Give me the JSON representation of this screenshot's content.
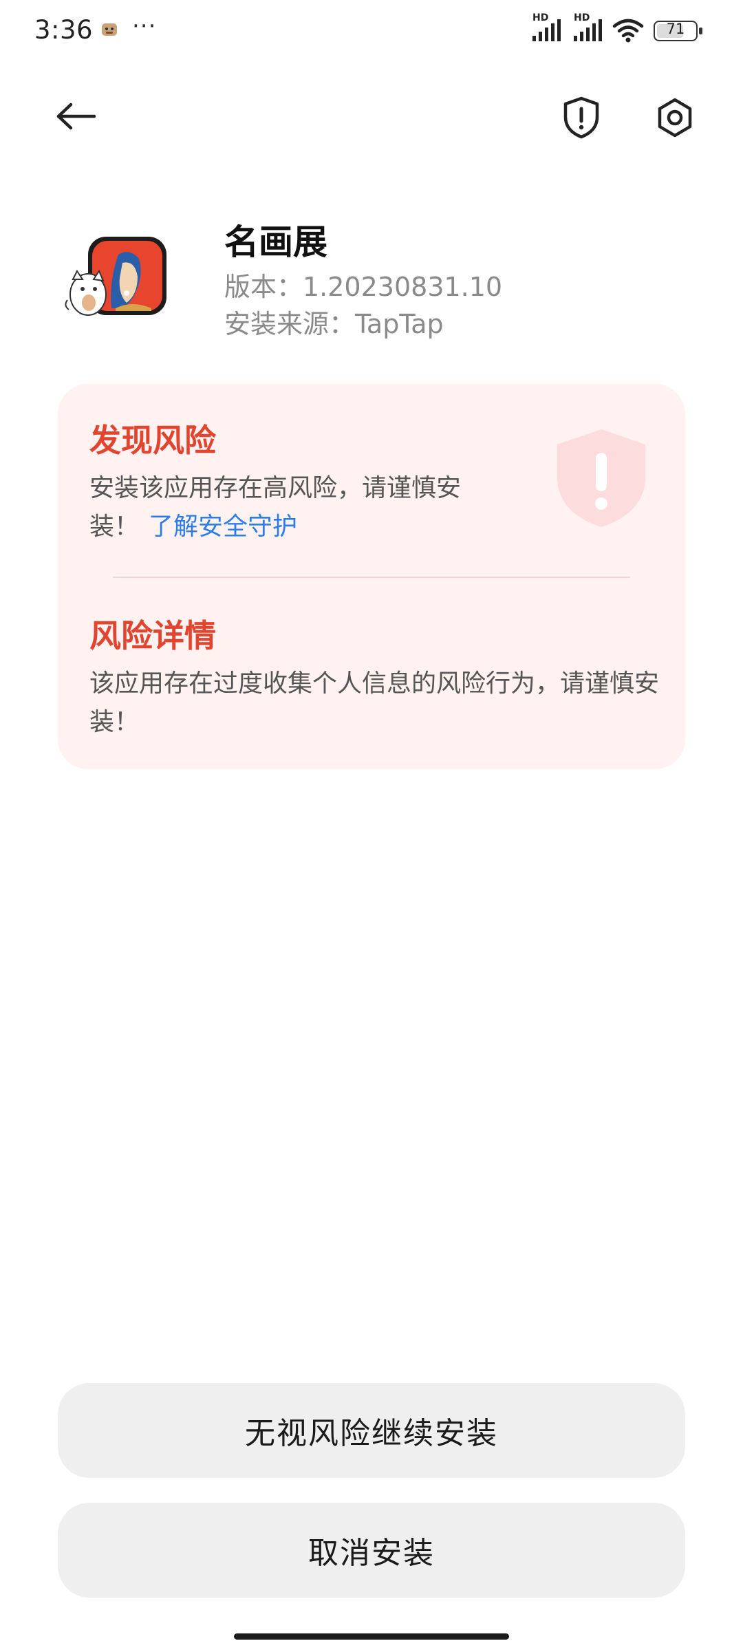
{
  "status_bar": {
    "time": "3:36",
    "more": "···",
    "signal_label_1": "HD",
    "signal_label_2": "HD",
    "battery": "71",
    "battery_level": 0.71
  },
  "nav": {
    "back_icon": "arrow-left-icon",
    "shield_icon": "shield-exclamation-icon",
    "settings_icon": "hexagon-gear-icon"
  },
  "app": {
    "name": "名画展",
    "version": "版本：1.20230831.10",
    "source": "安装来源：TapTap",
    "icon": "app-icon"
  },
  "risk": {
    "title": "发现风险",
    "description": "安装该应用存在高风险，请谨慎安装！",
    "link": "了解安全守护",
    "detail_title": "风险详情",
    "detail_description": "该应用存在过度收集个人信息的风险行为，请谨慎安装！"
  },
  "actions": {
    "continue_label": "无视风险继续安装",
    "cancel_label": "取消安装"
  },
  "colors": {
    "risk_red": "#e2452f",
    "link_blue": "#2b7de9",
    "card_bg": "#fff2f0",
    "button_bg": "#efefef"
  }
}
